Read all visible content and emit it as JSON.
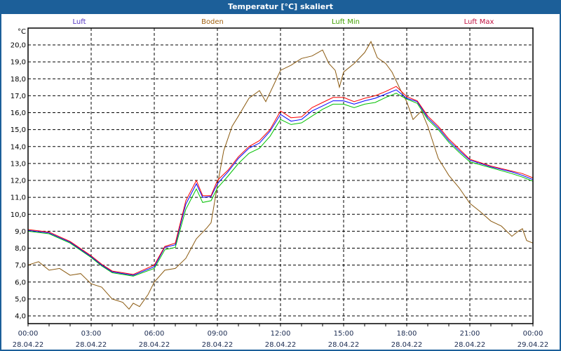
{
  "title": "Temperatur [°C] skaliert",
  "chart_data": {
    "type": "line",
    "title": "Temperatur [°C] skaliert",
    "ylabel": "°C",
    "ylim": [
      4,
      20
    ],
    "yticks": [
      "4,0",
      "5,0",
      "6,0",
      "7,0",
      "8,0",
      "9,0",
      "10,0",
      "11,0",
      "12,0",
      "13,0",
      "14,0",
      "15,0",
      "16,0",
      "17,0",
      "18,0",
      "19,0",
      "20,0"
    ],
    "xlim_hours": [
      0,
      24
    ],
    "xticks": [
      {
        "time": "00:00",
        "date": "28.04.22"
      },
      {
        "time": "03:00",
        "date": "28.04.22"
      },
      {
        "time": "06:00",
        "date": "28.04.22"
      },
      {
        "time": "09:00",
        "date": "28.04.22"
      },
      {
        "time": "12:00",
        "date": "28.04.22"
      },
      {
        "time": "15:00",
        "date": "28.04.22"
      },
      {
        "time": "18:00",
        "date": "28.04.22"
      },
      {
        "time": "21:00",
        "date": "28.04.22"
      },
      {
        "time": "00:00",
        "date": "29.04.22"
      }
    ],
    "grid": true,
    "legend_position": "top",
    "series": [
      {
        "name": "Luft",
        "color": "#0000ff",
        "label_color": "#5030c0",
        "x": [
          0,
          1,
          2,
          3,
          3.5,
          4,
          5,
          6,
          6.5,
          7,
          7.5,
          8,
          8.3,
          8.7,
          9,
          9.5,
          10,
          10.5,
          11,
          11.5,
          12,
          12.5,
          13,
          13.5,
          14,
          14.5,
          15,
          15.5,
          16,
          16.5,
          17,
          17.5,
          18,
          18.5,
          19,
          19.5,
          20,
          20.5,
          21,
          22,
          23,
          23.5,
          24
        ],
        "y": [
          9.05,
          8.9,
          8.35,
          7.5,
          7.0,
          6.6,
          6.4,
          6.9,
          8.05,
          8.2,
          10.6,
          11.8,
          11.0,
          11.05,
          11.8,
          12.5,
          13.3,
          13.9,
          14.2,
          14.9,
          15.9,
          15.5,
          15.6,
          16.1,
          16.4,
          16.7,
          16.7,
          16.5,
          16.7,
          16.85,
          17.1,
          17.35,
          16.85,
          16.65,
          15.7,
          15.1,
          14.35,
          13.75,
          13.2,
          12.8,
          12.5,
          12.3,
          12.05
        ]
      },
      {
        "name": "Boden",
        "color": "#8b5a10",
        "label_color": "#a06010",
        "x": [
          0,
          0.5,
          1,
          1.5,
          2,
          2.5,
          3,
          3.5,
          4,
          4.5,
          4.8,
          5,
          5.3,
          5.7,
          6,
          6.5,
          7,
          7.5,
          8,
          8.5,
          8.7,
          9,
          9.3,
          9.7,
          10,
          10.5,
          11,
          11.3,
          11.7,
          12,
          12.5,
          13,
          13.5,
          14,
          14.3,
          14.6,
          14.8,
          15,
          15.5,
          16,
          16.3,
          16.6,
          17,
          17.3,
          17.7,
          18,
          18.3,
          18.7,
          19,
          19.5,
          20,
          20.5,
          21,
          21.5,
          22,
          22.5,
          23,
          23.3,
          23.5,
          23.7,
          24
        ],
        "y": [
          7.0,
          7.2,
          6.7,
          6.8,
          6.4,
          6.5,
          5.9,
          5.7,
          5.0,
          4.8,
          4.4,
          4.75,
          4.55,
          5.25,
          6.0,
          6.7,
          6.8,
          7.4,
          8.55,
          9.2,
          9.5,
          11.7,
          13.75,
          15.2,
          15.8,
          16.85,
          17.3,
          16.65,
          17.7,
          18.5,
          18.8,
          19.2,
          19.35,
          19.7,
          18.9,
          18.5,
          17.5,
          18.4,
          18.9,
          19.55,
          20.2,
          19.25,
          18.9,
          18.4,
          17.35,
          16.65,
          15.6,
          16.1,
          15.2,
          13.3,
          12.3,
          11.55,
          10.65,
          10.15,
          9.6,
          9.3,
          8.7,
          9.0,
          9.15,
          8.45,
          8.3
        ]
      },
      {
        "name": "Luft Min",
        "color": "#00c000",
        "label_color": "#40a000",
        "x": [
          0,
          1,
          2,
          3,
          3.5,
          4,
          5,
          6,
          6.5,
          7,
          7.5,
          8,
          8.3,
          8.7,
          9,
          9.5,
          10,
          10.5,
          11,
          11.5,
          12,
          12.5,
          13,
          13.5,
          14,
          14.5,
          15,
          15.5,
          16,
          16.5,
          17,
          17.5,
          18,
          18.5,
          19,
          19.5,
          20,
          20.5,
          21,
          22,
          23,
          23.5,
          24
        ],
        "y": [
          9.0,
          8.85,
          8.3,
          7.45,
          6.95,
          6.55,
          6.35,
          6.8,
          7.9,
          8.05,
          10.3,
          11.5,
          10.7,
          10.8,
          11.55,
          12.25,
          13.0,
          13.6,
          13.9,
          14.6,
          15.6,
          15.3,
          15.4,
          15.8,
          16.2,
          16.5,
          16.5,
          16.3,
          16.5,
          16.6,
          16.9,
          17.15,
          16.8,
          16.55,
          15.6,
          15.0,
          14.25,
          13.65,
          13.1,
          12.75,
          12.4,
          12.2,
          11.95
        ]
      },
      {
        "name": "Luft Max",
        "color": "#ff0000",
        "label_color": "#c01040",
        "x": [
          0,
          1,
          2,
          3,
          3.5,
          4,
          5,
          6,
          6.5,
          7,
          7.5,
          8,
          8.3,
          8.7,
          9,
          9.5,
          10,
          10.5,
          11,
          11.5,
          12,
          12.5,
          13,
          13.5,
          14,
          14.5,
          15,
          15.5,
          16,
          16.5,
          17,
          17.5,
          18,
          18.5,
          19,
          19.5,
          20,
          20.5,
          21,
          22,
          23,
          23.5,
          24
        ],
        "y": [
          9.1,
          8.95,
          8.4,
          7.55,
          7.05,
          6.65,
          6.45,
          7.0,
          8.1,
          8.3,
          10.8,
          12.0,
          11.1,
          11.1,
          12.0,
          12.6,
          13.4,
          14.0,
          14.35,
          15.0,
          16.1,
          15.7,
          15.75,
          16.3,
          16.6,
          16.9,
          16.9,
          16.65,
          16.85,
          17.0,
          17.25,
          17.55,
          16.95,
          16.7,
          15.8,
          15.2,
          14.45,
          13.85,
          13.25,
          12.85,
          12.55,
          12.4,
          12.15
        ]
      }
    ]
  }
}
